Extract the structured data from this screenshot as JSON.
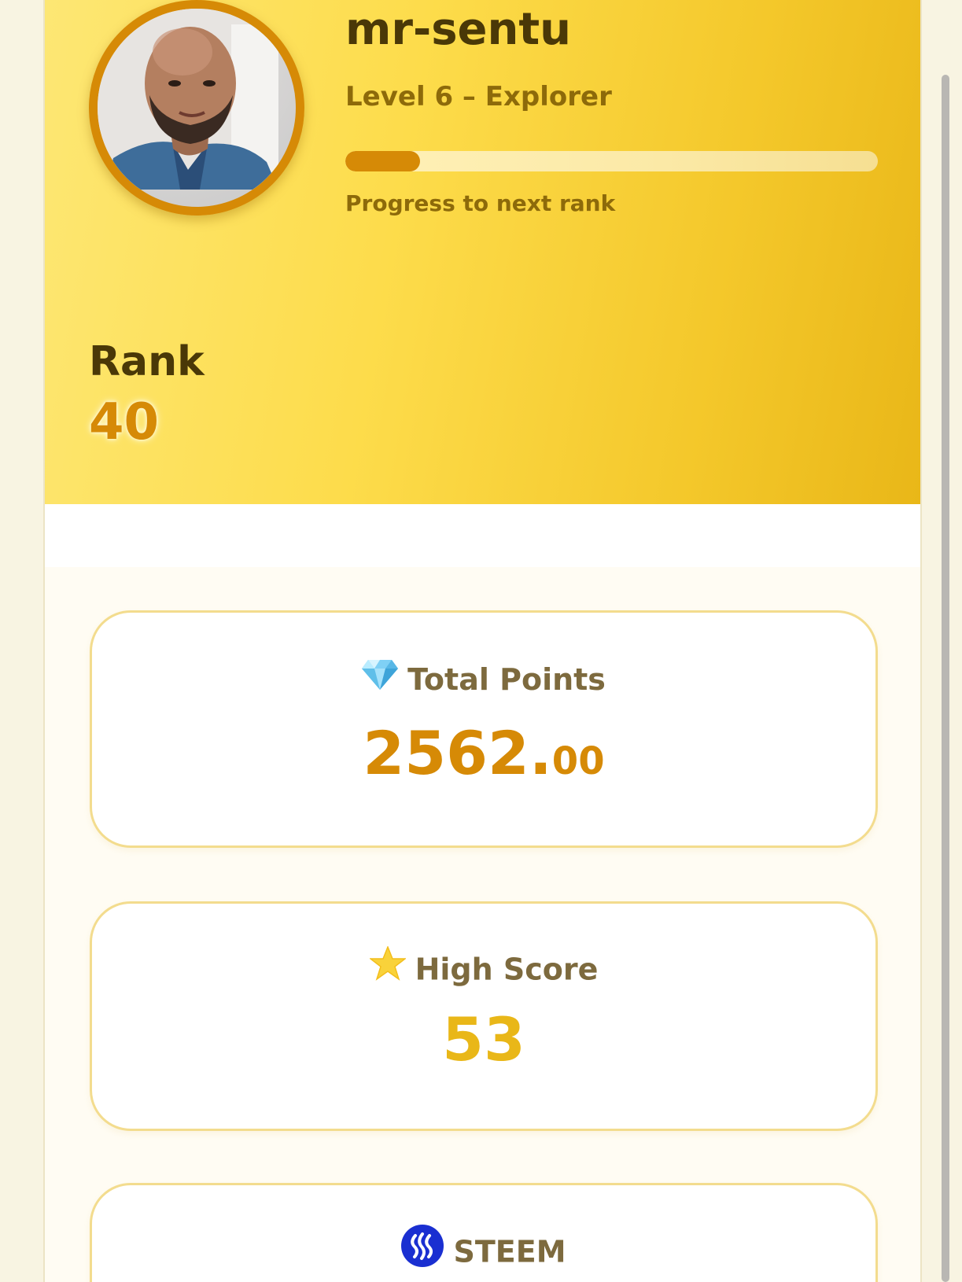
{
  "profile": {
    "username": "mr-sentu",
    "level_text": "Level 6 – Explorer",
    "progress_fraction": 0.14,
    "progress_caption": "Progress to next rank",
    "rank_label": "Rank",
    "rank_value": "40"
  },
  "stats": {
    "total_points": {
      "icon": "diamond-icon",
      "label": "Total Points",
      "value_main": "2562.",
      "value_decimal": "00"
    },
    "high_score": {
      "icon": "star-icon",
      "label": "High Score",
      "value": "53"
    },
    "steem": {
      "icon": "steem-logo-icon",
      "label": "STEEM"
    }
  },
  "colors": {
    "accent": "#d68a06",
    "gold": "#e9b718",
    "steem_blue": "#1a2fd1"
  }
}
